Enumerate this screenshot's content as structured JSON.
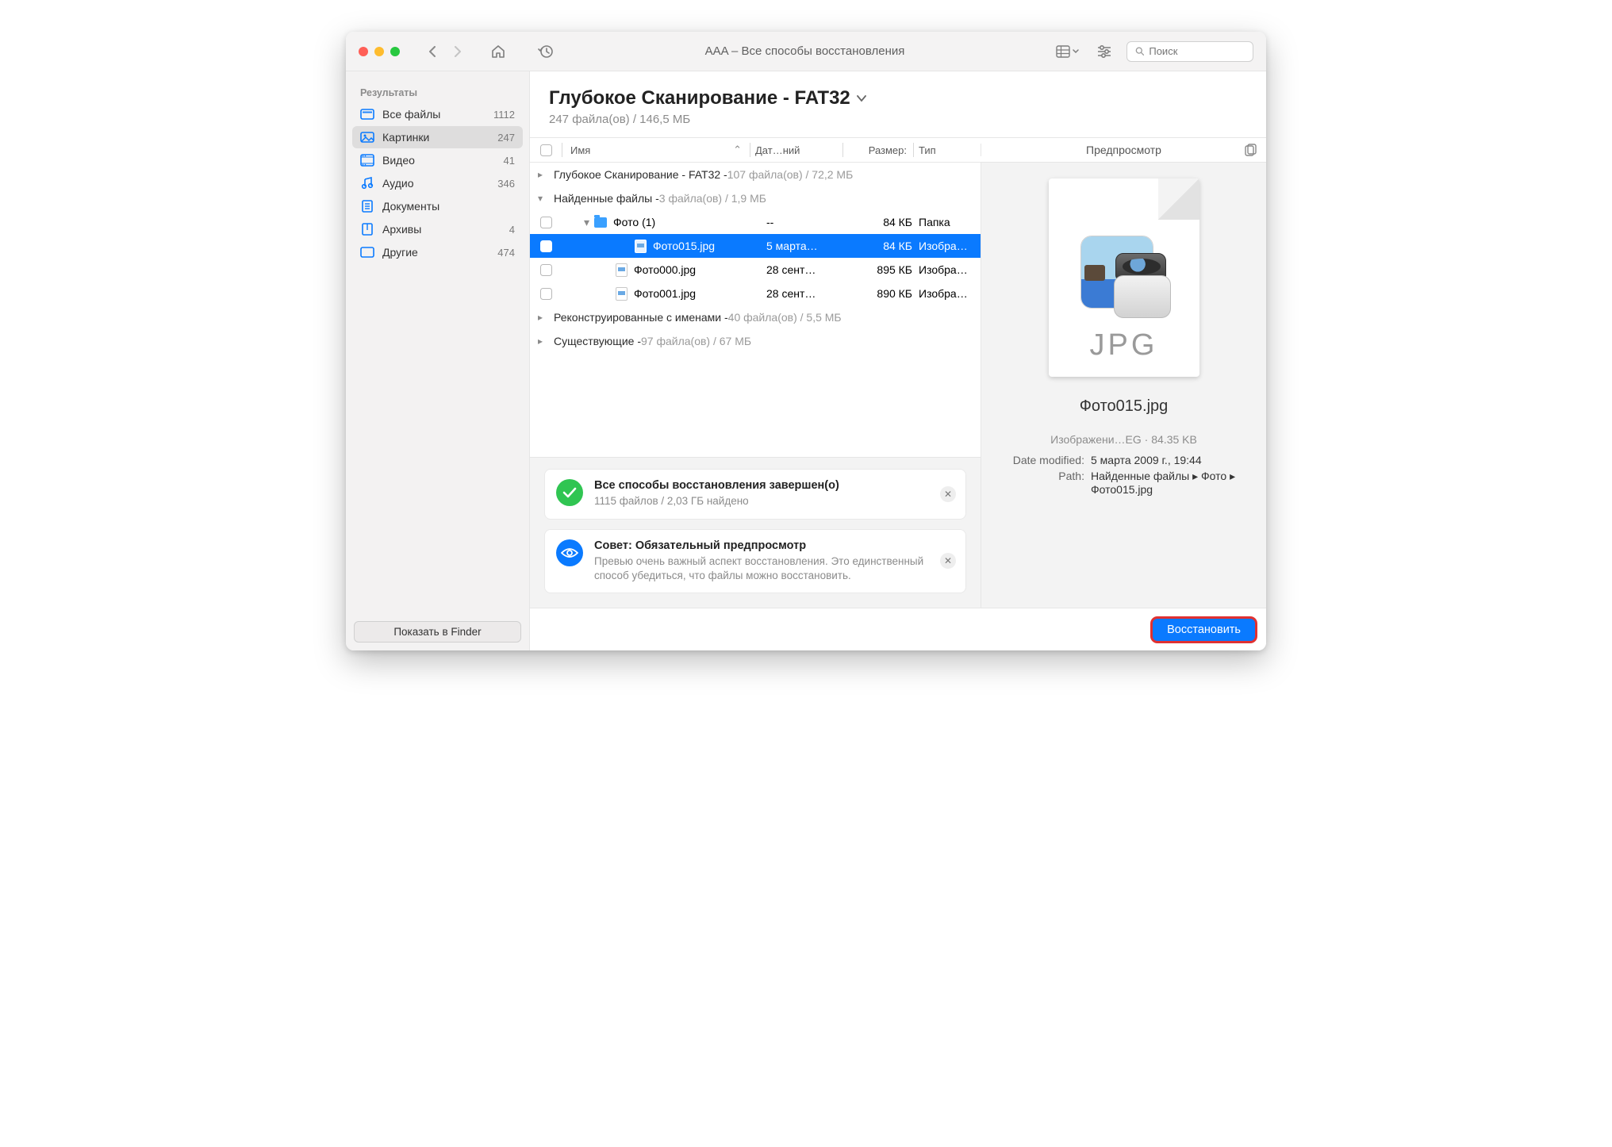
{
  "window": {
    "title": "AAA – Все способы восстановления"
  },
  "search": {
    "placeholder": "Поиск"
  },
  "sidebar": {
    "header": "Результаты",
    "items": [
      {
        "label": "Все файлы",
        "count": "1112"
      },
      {
        "label": "Картинки",
        "count": "247"
      },
      {
        "label": "Видео",
        "count": "41"
      },
      {
        "label": "Аудио",
        "count": "346"
      },
      {
        "label": "Документы",
        "count": ""
      },
      {
        "label": "Архивы",
        "count": "4"
      },
      {
        "label": "Другие",
        "count": "474"
      }
    ],
    "finder_button": "Показать в Finder"
  },
  "main": {
    "title": "Глубокое Сканирование - FAT32",
    "subtitle": "247 файла(ов) / 146,5 МБ"
  },
  "columns": {
    "name": "Имя",
    "date": "Дат…ний",
    "size": "Размер:",
    "type": "Тип",
    "preview": "Предпросмотр"
  },
  "groups": {
    "g1_name": "Глубокое Сканирование - FAT32 - ",
    "g1_meta": "107 файла(ов) / 72,2 МБ",
    "g2_name": "Найденные файлы - ",
    "g2_meta": "3 файла(ов) / 1,9 МБ",
    "g3_name": "Реконструированные с именами - ",
    "g3_meta": "40 файла(ов) / 5,5 МБ",
    "g4_name": "Существующие - ",
    "g4_meta": "97 файла(ов) / 67 МБ"
  },
  "folder": {
    "name": "Фото (1)",
    "date": "--",
    "size": "84 КБ",
    "type": "Папка"
  },
  "files": [
    {
      "name": "Фото015.jpg",
      "date": "5 марта…",
      "size": "84 КБ",
      "type": "Изобра…"
    },
    {
      "name": "Фото000.jpg",
      "date": "28 сент…",
      "size": "895 КБ",
      "type": "Изобра…"
    },
    {
      "name": "Фото001.jpg",
      "date": "28 сент…",
      "size": "890 КБ",
      "type": "Изобра…"
    }
  ],
  "status": {
    "done_title": "Все способы восстановления завершен(о)",
    "done_sub": "1115 файлов / 2,03 ГБ найдено",
    "tip_title": "Совет: Обязательный предпросмотр",
    "tip_sub": "Превью очень важный аспект восстановления. Это единственный способ убедиться, что файлы можно восстановить."
  },
  "preview": {
    "badge": "JPG",
    "filename": "Фото015.jpg",
    "meta1": "Изображени…EG · 84.35 KB",
    "date_label": "Date modified:",
    "date_value": "5 марта 2009 г., 19:44",
    "path_label": "Path:",
    "path_value": "Найденные файлы ▸ Фото ▸ Фото015.jpg"
  },
  "footer": {
    "recover": "Восстановить"
  }
}
